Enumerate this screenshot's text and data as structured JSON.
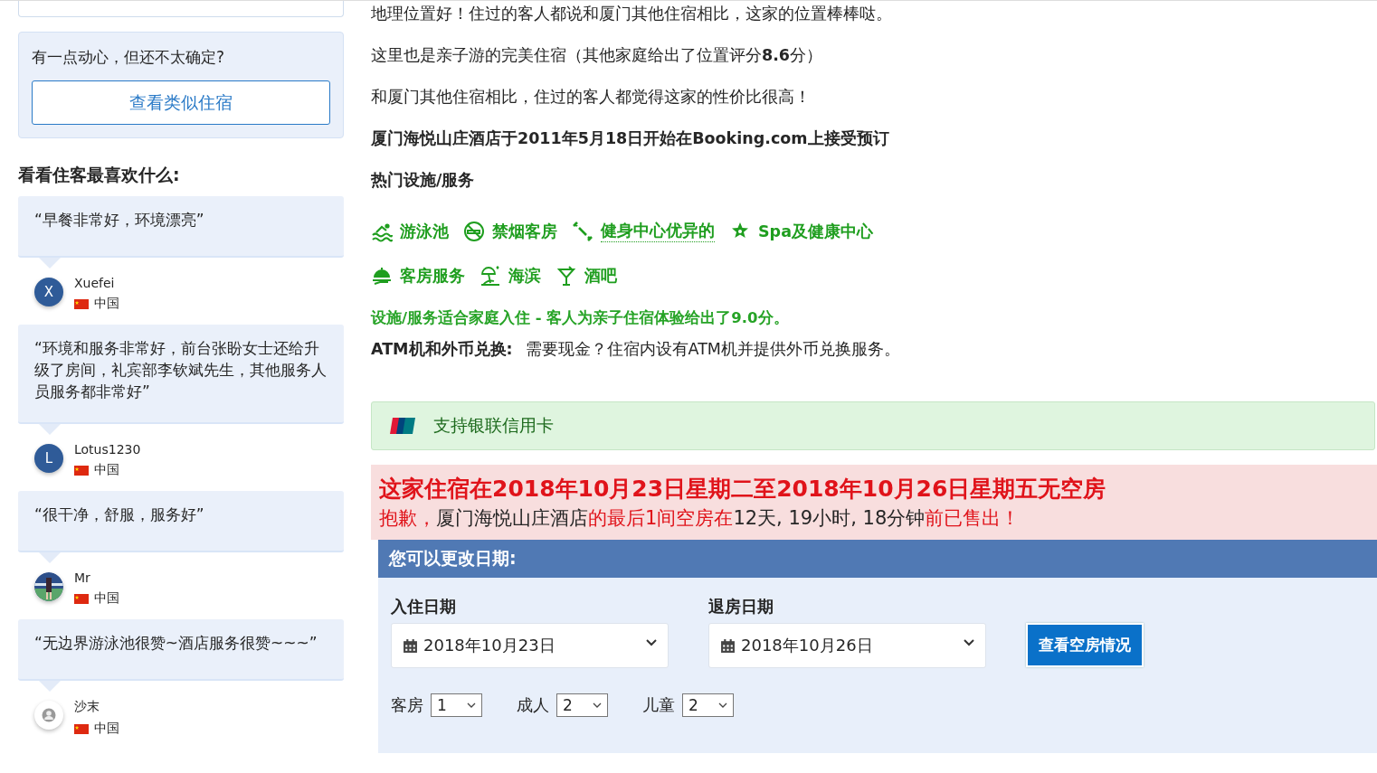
{
  "sidebar": {
    "prompt_card": {
      "text": "有一点动心，但还不太确定?",
      "button": "查看类似住宿"
    },
    "reviews_heading": "看看住客最喜欢什么:",
    "reviews": [
      {
        "quote": "“早餐非常好，环境漂亮”",
        "name": "Xuefei",
        "country": "中国",
        "avatar": {
          "kind": "letter",
          "letter": "X"
        }
      },
      {
        "quote": "“环境和服务非常好，前台张盼女士还给升级了房间，礼宾部李钦斌先生，其他服务人员服务都非常好”",
        "name": "Lotus1230",
        "country": "中国",
        "avatar": {
          "kind": "letter",
          "letter": "L"
        }
      },
      {
        "quote": "“很干净，舒服，服务好”",
        "name": "Mr",
        "country": "中国"
      },
      {
        "quote": "“无边界游泳池很赞~酒店服务很赞~~~”",
        "name": "沙末",
        "country": "中国",
        "avatar": {
          "kind": "default"
        }
      }
    ]
  },
  "main": {
    "paragraphs": [
      "地理位置好！住过的客人都说和厦门其他住宿相比，这家的位置棒棒哒。",
      "这里也是亲子游的完美住宿（其他家庭给出了位置评分**8.6**分）",
      "和厦门其他住宿相比，住过的客人都觉得这家的性价比很高！"
    ],
    "since": "厦门海悦山庄酒店于2011年5月18日开始在Booking.com上接受预订",
    "facilities_heading": "热门设施/服务",
    "facilities": [
      [
        {
          "kind": "pool",
          "label": "游泳池",
          "underlined": false
        },
        {
          "kind": "nosmoking",
          "label": "禁烟客房",
          "underlined": false
        },
        {
          "kind": "fitness",
          "label": "健身中心优异的",
          "underlined": true
        },
        {
          "kind": "spa",
          "label": "Spa及健康中心",
          "underlined": false
        }
      ],
      [
        {
          "kind": "service",
          "label": "客房服务",
          "underlined": false
        },
        {
          "kind": "beach",
          "label": "海滨",
          "underlined": false
        },
        {
          "kind": "bar",
          "label": "酒吧",
          "underlined": false
        }
      ]
    ],
    "family_note": "设施/服务适合家庭入住 - 客人为亲子住宿体验给出了9.0分。",
    "atm": {
      "label": "ATM机和外币兑换:",
      "text": "需要现金？住宿内设有ATM机并提供外币兑换服务。"
    },
    "card_notice": "支持银联信用卡",
    "unavailable": {
      "title": "这家住宿在2018年10月23日星期二至2018年10月26日星期五无空房",
      "segments": [
        {
          "text": "抱歉，",
          "highlight": true
        },
        {
          "text": "厦门海悦山庄酒店",
          "highlight": false
        },
        {
          "text": "的最后1间空房在",
          "highlight": true
        },
        {
          "text": "12天, 19小时, 18分钟",
          "highlight": false
        },
        {
          "text": "前已售出！",
          "highlight": true
        }
      ]
    },
    "change_dates": {
      "title": "您可以更改日期:",
      "checkin": {
        "label": "入住日期",
        "value": "2018年10月23日"
      },
      "checkout": {
        "label": "退房日期",
        "value": "2018年10月26日"
      },
      "button": "查看空房情况",
      "selects": [
        {
          "label": "客房",
          "value": "1"
        },
        {
          "label": "成人",
          "value": "2"
        },
        {
          "label": "儿童",
          "value": "2"
        }
      ]
    }
  }
}
